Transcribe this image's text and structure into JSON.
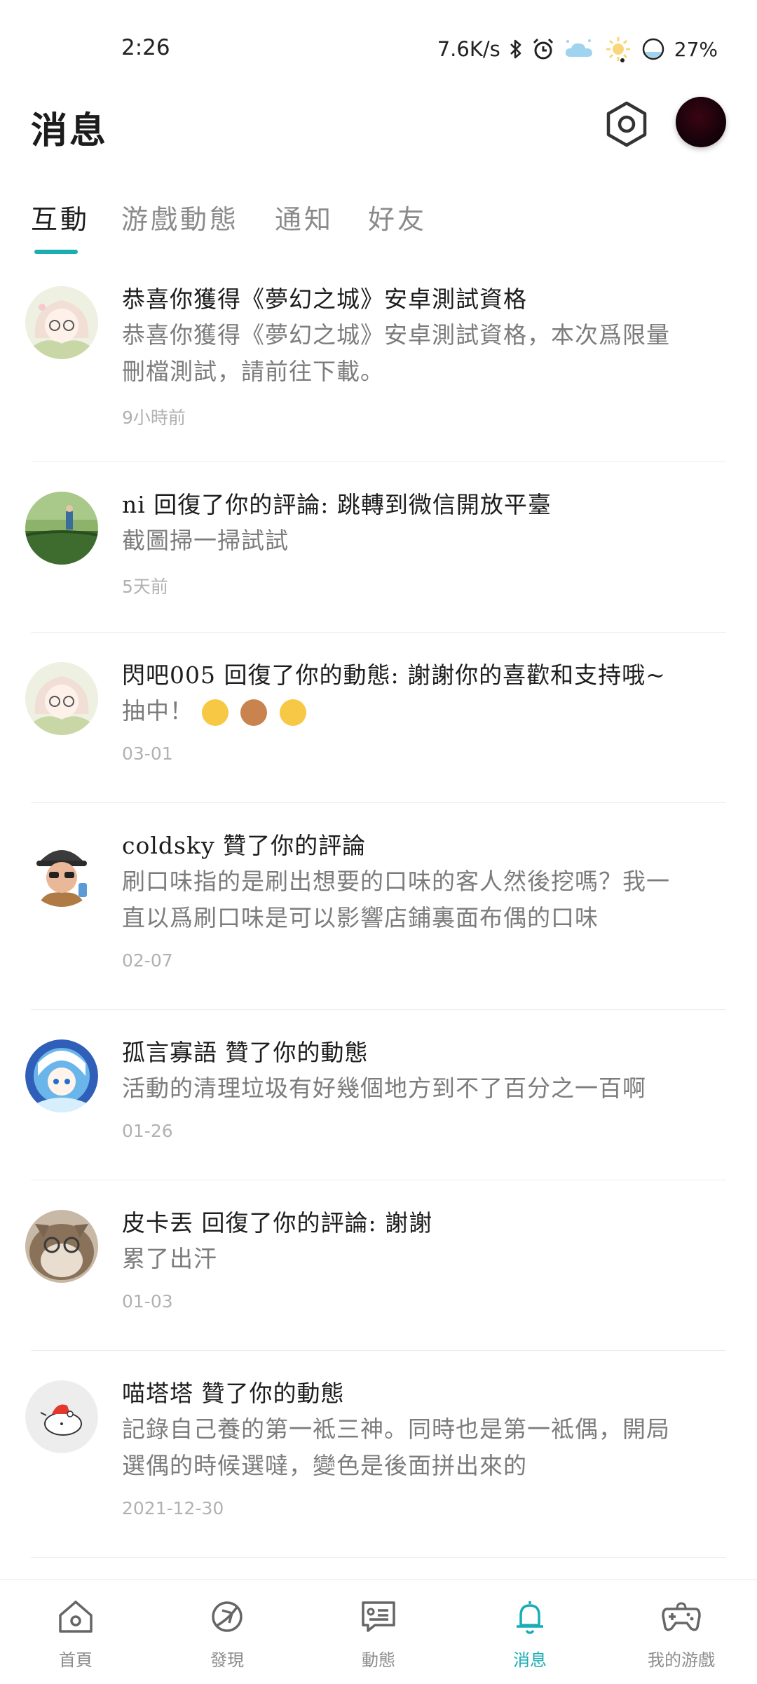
{
  "status_bar": {
    "time": "2:26",
    "network_speed": "7.6K/s",
    "battery": "27%"
  },
  "header": {
    "title": "消息"
  },
  "tabs": [
    {
      "label": "互動",
      "active": true
    },
    {
      "label": "游戲動態",
      "active": false
    },
    {
      "label": "通知",
      "active": false
    },
    {
      "label": "好友",
      "active": false
    }
  ],
  "messages": [
    {
      "title": "恭喜你獲得《夢幻之城》安卓測試資格",
      "body_line1": "恭喜你獲得《夢幻之城》安卓測試資格，本次爲限量",
      "body_line2": "刪檔測試，請前往下載。",
      "time": "9小時前"
    },
    {
      "title": "ni 回復了你的評論: 跳轉到微信開放平臺",
      "body_line1": "截圖掃一掃試試",
      "time": "5天前"
    },
    {
      "title": "閃吧005 回復了你的動態: 謝謝你的喜歡和支持哦~",
      "body_line1": "抽中！",
      "time": "03-01"
    },
    {
      "title": "coldsky 贊了你的評論",
      "body_line1": "刷口味指的是刷出想要的口味的客人然後挖嗎？我一",
      "body_line2": "直以爲刷口味是可以影響店鋪裏面布偶的口味",
      "time": "02-07"
    },
    {
      "title": "孤言寡語 贊了你的動態",
      "body_line1": "活動的清理垃圾有好幾個地方到不了百分之一百啊",
      "time": "01-26"
    },
    {
      "title": "皮卡丟 回復了你的評論: 謝謝",
      "body_line1": "累了出汗",
      "time": "01-03"
    },
    {
      "title": "喵塔塔 贊了你的動態",
      "body_line1": "記錄自己養的第一袛三神。同時也是第一袛偶，開局",
      "body_line2": "選偶的時候選噠，變色是後面拼出來的",
      "time": "2021-12-30"
    }
  ],
  "bottom_nav": [
    {
      "label": "首頁",
      "icon": "home-icon",
      "active": false
    },
    {
      "label": "發現",
      "icon": "compass-icon",
      "active": false
    },
    {
      "label": "動態",
      "icon": "feed-icon",
      "active": false
    },
    {
      "label": "消息",
      "icon": "bell-icon",
      "active": true
    },
    {
      "label": "我的游戲",
      "icon": "gamepad-icon",
      "active": false
    }
  ],
  "colors": {
    "accent": "#1aaeb4",
    "text_primary": "#1d1d1d",
    "text_secondary": "#7c7c7c",
    "text_muted": "#b1b1b1"
  }
}
